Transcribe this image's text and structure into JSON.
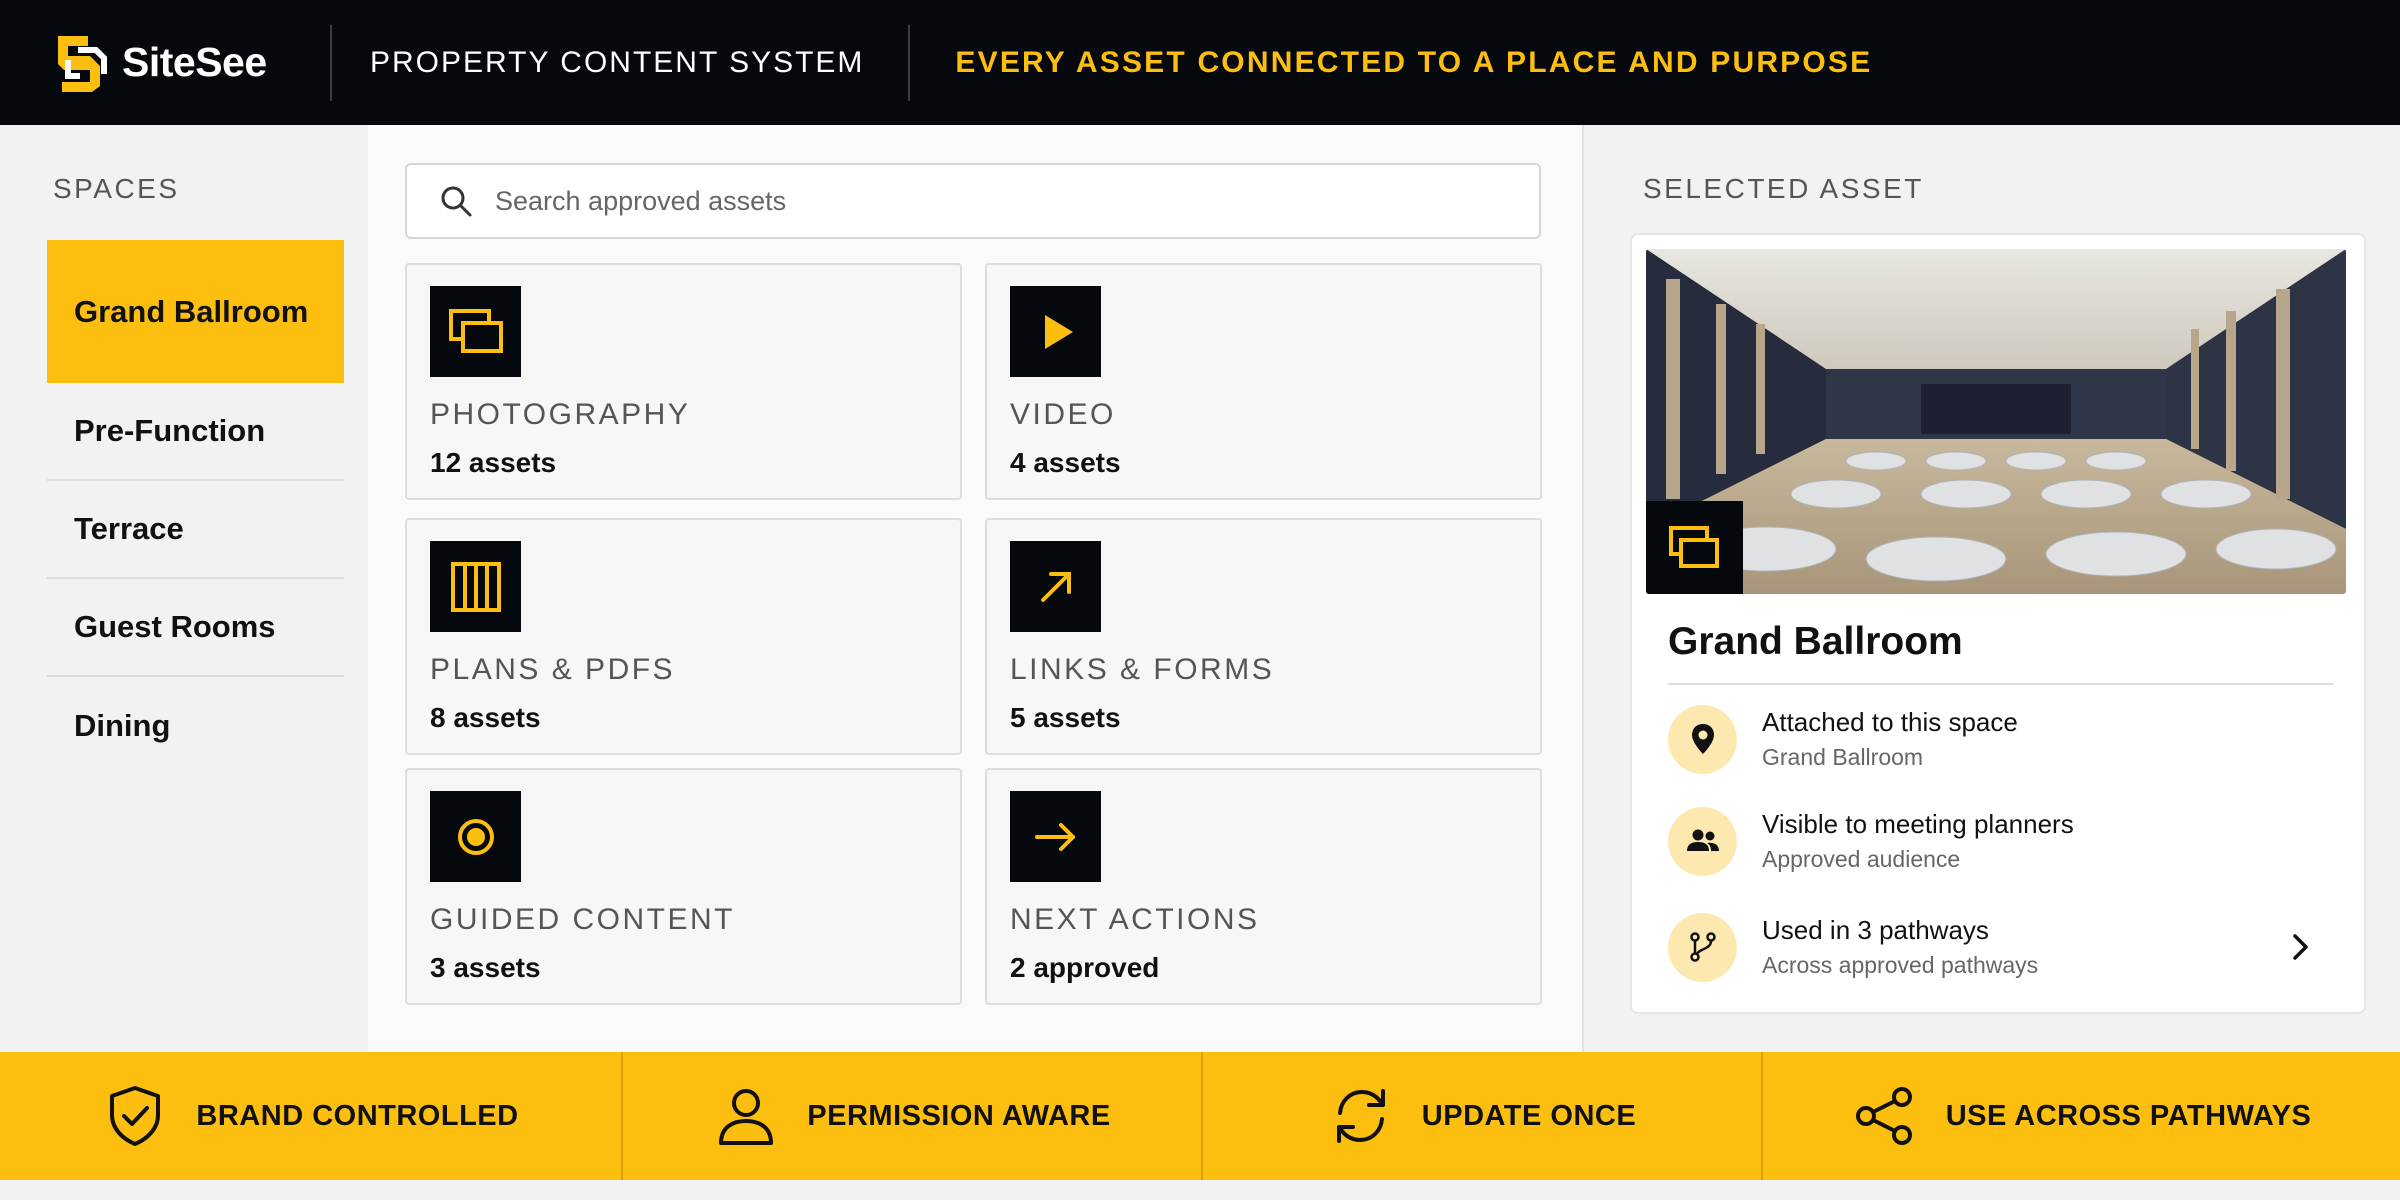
{
  "header": {
    "brand": "SiteSee",
    "system_title": "PROPERTY CONTENT SYSTEM",
    "tagline": "EVERY ASSET CONNECTED TO A PLACE AND PURPOSE"
  },
  "sidebar": {
    "label": "SPACES",
    "items": [
      {
        "label": "Grand Ballroom",
        "active": true
      },
      {
        "label": "Pre-Function",
        "active": false
      },
      {
        "label": "Terrace",
        "active": false
      },
      {
        "label": "Guest Rooms",
        "active": false
      },
      {
        "label": "Dining",
        "active": false
      }
    ]
  },
  "search": {
    "placeholder": "Search approved assets",
    "value": ""
  },
  "categories": [
    {
      "name": "PHOTOGRAPHY",
      "count": "12 assets",
      "icon": "photo-stack-icon"
    },
    {
      "name": "VIDEO",
      "count": "4 assets",
      "icon": "play-icon"
    },
    {
      "name": "PLANS & PDFS",
      "count": "8 assets",
      "icon": "floor-plan-icon"
    },
    {
      "name": "LINKS & FORMS",
      "count": "5 assets",
      "icon": "arrow-up-right-icon"
    },
    {
      "name": "GUIDED CONTENT",
      "count": "3 assets",
      "icon": "target-icon"
    },
    {
      "name": "NEXT ACTIONS",
      "count": "2 approved",
      "icon": "arrow-right-icon"
    }
  ],
  "selected": {
    "label": "SELECTED ASSET",
    "title": "Grand Ballroom",
    "image": "ballroom-photo",
    "properties": [
      {
        "title": "Attached to this space",
        "detail": "Grand Ballroom",
        "icon": "location-pin-icon"
      },
      {
        "title": "Visible to meeting planners",
        "detail": "Approved audience",
        "icon": "users-icon"
      },
      {
        "title": "Used in 3 pathways",
        "detail": "Across approved pathways",
        "icon": "pathway-icon"
      }
    ]
  },
  "footer": [
    {
      "label": "BRAND CONTROLLED",
      "icon": "shield-check-icon"
    },
    {
      "label": "PERMISSION AWARE",
      "icon": "user-icon"
    },
    {
      "label": "UPDATE ONCE",
      "icon": "refresh-icon"
    },
    {
      "label": "USE ACROSS PATHWAYS",
      "icon": "share-nodes-icon"
    }
  ],
  "colors": {
    "accent": "#fcbf10",
    "header_bg": "#05080d",
    "icon_bg": "#05080d"
  }
}
